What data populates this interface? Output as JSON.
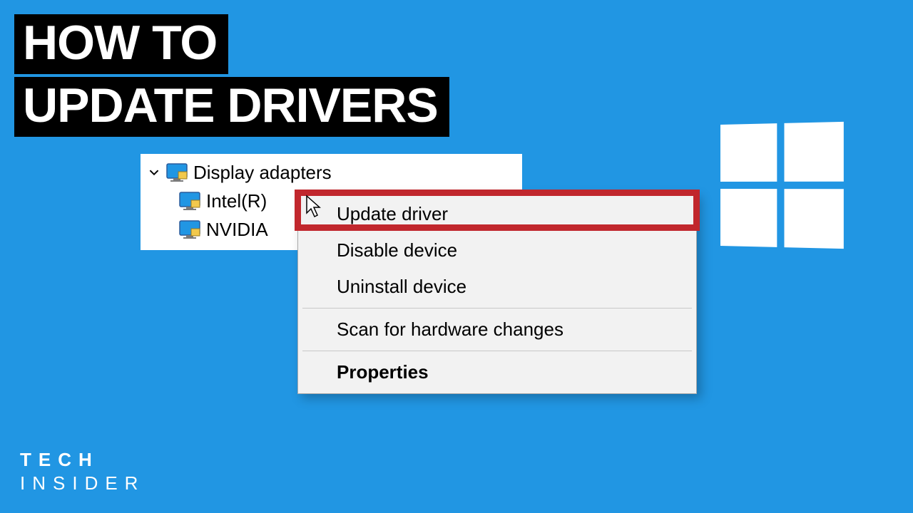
{
  "title": {
    "line1": "HOW TO",
    "line2": "UPDATE DRIVERS"
  },
  "tree": {
    "parent": "Display adapters",
    "children": [
      "Intel(R)",
      "NVIDIA"
    ]
  },
  "menu": {
    "items": [
      {
        "label": "Update driver",
        "highlighted": true
      },
      {
        "label": "Disable device"
      },
      {
        "label": "Uninstall device"
      }
    ],
    "items2": [
      {
        "label": "Scan for hardware changes"
      }
    ],
    "items3": [
      {
        "label": "Properties",
        "bold": true
      }
    ]
  },
  "brand": {
    "line1": "TECH",
    "line2": "INSIDER"
  },
  "icons": {
    "chevron": "chevron-down-icon",
    "display_adapter": "display-adapter-icon",
    "windows": "windows-logo-icon",
    "cursor": "cursor-icon"
  }
}
